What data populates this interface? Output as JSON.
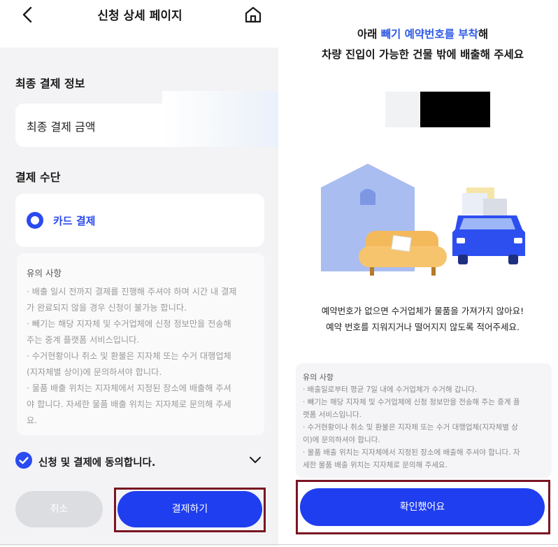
{
  "left_screen": {
    "header": {
      "title": "신청 상세 페이지",
      "back_icon": "chevron-left-icon",
      "home_icon": "home-icon"
    },
    "final_payment": {
      "section_title": "최종 결제 정보",
      "amount_label": "최종 결제 금액"
    },
    "payment_method": {
      "section_title": "결제 수단",
      "option_label": "카드 결제",
      "selected": true
    },
    "notice": {
      "title": "유의 사항",
      "lines": [
        "· 배출 일시 전까지 결제를 진행해 주셔야 하며 시간 내 결제",
        "가 완료되지 않을 경우 신청이 불가능 합니다.",
        "· 빼기는 해당 지자체 및 수거업체에 신청 정보만을 전송해",
        "주는 중계 플랫폼 서비스입니다.",
        "· 수거현황이나 취소 및 환불은 지자체 또는 수거 대행업체",
        "(지자체별 상이)에 문의하셔야 합니다.",
        "· 물품 배출 위치는 지자체에서 지정된 장소에 배출해 주셔",
        "야 합니다. 자세한 물품 배출 위치는 지자체로 문의해 주세",
        "요."
      ]
    },
    "agreement": {
      "label": "신청 및 결제에 동의합니다.",
      "checked": true
    },
    "buttons": {
      "cancel": "취소",
      "pay": "결제하기"
    }
  },
  "right_screen": {
    "headline": {
      "line1_prefix": "아래 ",
      "line1_accent": "빼기 예약번호를 부착",
      "line1_suffix": "해",
      "line2": "차량 진입이 가능한 건물 밖에 배출해 주세요"
    },
    "warning": {
      "line1": "예약번호가 없으면 수거업체가 물품을 가져가지 않아요!",
      "line2": "예약 번호를 지워지거나 떨어지지 않도록 적어주세요."
    },
    "notice": {
      "title": "유의 사항",
      "lines": [
        "· 배출일로부터 평균 7일 내에 수거업체가 수거해 갑니다.",
        "· 빼기는 해당 지자체 및 수거업체에 신청 정보만을 전송해 주는 중계 플",
        "랫폼 서비스입니다.",
        "· 수거현황이나 취소 및 환불은 지자체 또는 수거 대행업체(지자체별 상",
        "이)에 문의하셔야 합니다.",
        "· 물품 배출 위치는 지자체에서 지정된 장소에 배출해 주셔야 합니다. 자",
        "세한 물품 배출 위치는 지자체로 문의해 주세요."
      ]
    },
    "buttons": {
      "confirm": "확인했어요"
    }
  },
  "colors": {
    "accent": "#1f3ef0",
    "accent_text": "#2f5be8",
    "highlight_box": "#7a1522"
  }
}
